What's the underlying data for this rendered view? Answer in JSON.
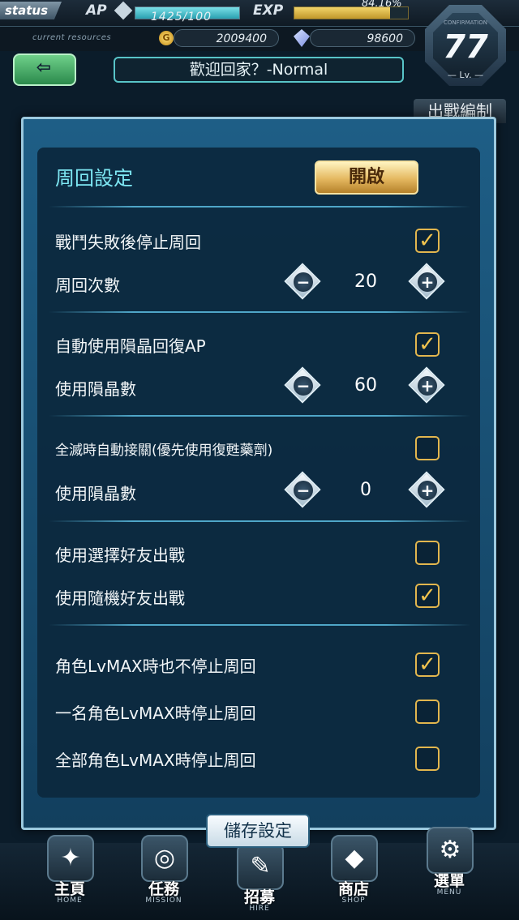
{
  "status": {
    "tag": "status",
    "ap_label": "AP",
    "ap_value": "1425/100",
    "ap_fraction": 1.0,
    "exp_label": "EXP",
    "exp_value": "84.16%",
    "exp_fraction": 0.8416,
    "resources_label": "current resources",
    "coin_glyph": "G",
    "gold": "2009400",
    "crystals": "98600",
    "level": "77",
    "level_unit": "— Lv. —",
    "level_caption": "CONFIRMATION"
  },
  "header": {
    "back_icon": "back-arrow-icon",
    "title": "歡迎回家？-Normal",
    "tab_behind": "出戰編制"
  },
  "modal": {
    "section_title": "周回設定",
    "toggle_label": "開啟",
    "rows": [
      {
        "type": "checkbox",
        "label": "戰鬥失敗後停止周回",
        "checked": true
      },
      {
        "type": "stepper",
        "label": "周回次數",
        "value": "20"
      },
      {
        "type": "checkbox",
        "label": "自動使用隕晶回復AP",
        "checked": true
      },
      {
        "type": "stepper",
        "label": "使用隕晶數",
        "value": "60"
      },
      {
        "type": "checkbox",
        "label": "全滅時自動接關(優先使用復甦藥劑)",
        "checked": false
      },
      {
        "type": "stepper",
        "label": "使用隕晶數",
        "value": "0"
      },
      {
        "type": "checkbox",
        "label": "使用選擇好友出戰",
        "checked": false
      },
      {
        "type": "checkbox",
        "label": "使用隨機好友出戰",
        "checked": true
      },
      {
        "type": "checkbox",
        "label": "角色LvMAX時也不停止周回",
        "checked": true
      },
      {
        "type": "checkbox",
        "label": "一名角色LvMAX時停止周回",
        "checked": false
      },
      {
        "type": "checkbox",
        "label": "全部角色LvMAX時停止周回",
        "checked": false
      }
    ],
    "minus_glyph": "−",
    "plus_glyph": "+",
    "checkmark_glyph": "✓",
    "save_label": "儲存設定"
  },
  "nav": [
    {
      "label": "主頁",
      "sub": "HOME",
      "icon": "home-feather-icon",
      "glyph": "✦"
    },
    {
      "label": "任務",
      "sub": "MISSION",
      "icon": "compass-icon",
      "glyph": "◎"
    },
    {
      "label": "招募",
      "sub": "HIRE",
      "icon": "quill-icon",
      "glyph": "✎"
    },
    {
      "label": "商店",
      "sub": "SHOP",
      "icon": "crystal-icon",
      "glyph": "◆"
    },
    {
      "label": "選單",
      "sub": "MENU",
      "icon": "gear-icon",
      "glyph": "⚙"
    }
  ],
  "colors": {
    "accent_cyan": "#7ee8f4",
    "checkbox_gold": "#e2b64e",
    "panel_blue": "#1e5e86"
  }
}
